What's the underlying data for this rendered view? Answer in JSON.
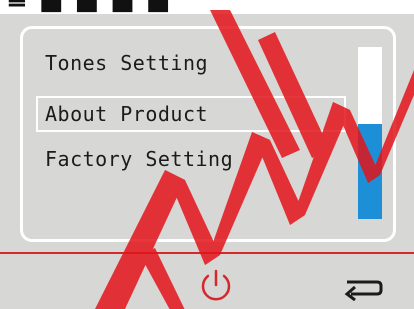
{
  "menu": {
    "items": [
      {
        "label": "Tones Setting"
      },
      {
        "label": "About Product",
        "selected": true
      },
      {
        "label": "Factory Setting"
      }
    ],
    "scroll_position_fraction": 0.45
  },
  "footer": {
    "power_icon": "power-icon",
    "back_icon": "back-arrow-icon"
  },
  "colors": {
    "background": "#d7d8d6",
    "accent_blue": "#1c8fd6",
    "divider_red": "#d4282b",
    "text": "#1b1b1b"
  }
}
